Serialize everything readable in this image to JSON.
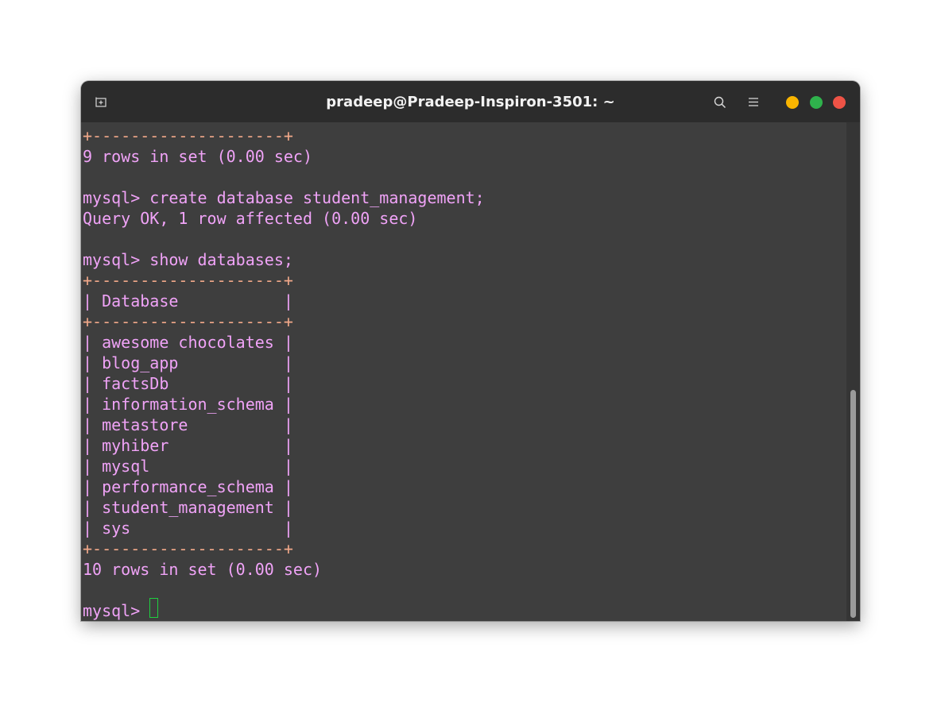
{
  "window": {
    "title": "pradeep@Pradeep-Inspiron-3501: ~"
  },
  "icons": {
    "new_tab": "new-tab-icon",
    "search": "search-icon",
    "menu": "hamburger-menu-icon"
  },
  "colors": {
    "terminal_bg": "#3e3e3e",
    "titlebar_bg": "#2c2c2c",
    "text": "#f0a3f7",
    "table_border": "#f1a889",
    "cursor": "#1fcf3f",
    "minimize": "#f9b500",
    "maximize": "#2fb24c",
    "close": "#ee5346"
  },
  "terminal": {
    "lines": [
      "+--------------------+",
      "9 rows in set (0.00 sec)",
      "",
      "mysql> create database student_management;",
      "Query OK, 1 row affected (0.00 sec)",
      "",
      "mysql> show databases;",
      "+--------------------+",
      "| Database           |",
      "+--------------------+",
      "| awesome chocolates |",
      "| blog_app           |",
      "| factsDb            |",
      "| information_schema |",
      "| metastore          |",
      "| myhiber            |",
      "| mysql              |",
      "| performance_schema |",
      "| student_management |",
      "| sys                |",
      "+--------------------+",
      "10 rows in set (0.00 sec)",
      "",
      "mysql> "
    ]
  }
}
